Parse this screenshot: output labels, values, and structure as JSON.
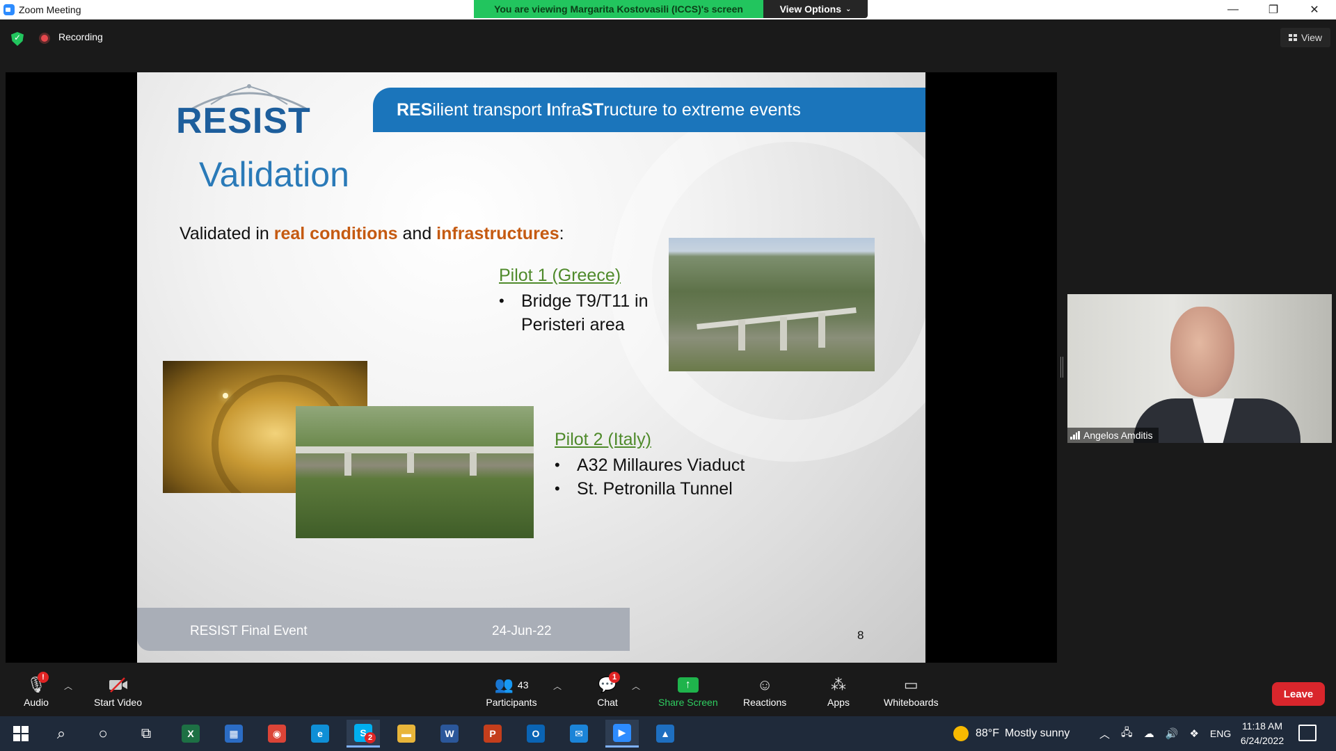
{
  "window": {
    "title": "Zoom Meeting",
    "viewing_banner": "You are viewing Margarita Kostovasili (ICCS)'s screen",
    "view_options": "View Options",
    "controls": {
      "minimize": "—",
      "restore": "❐",
      "close": "✕"
    }
  },
  "meeting": {
    "recording_label": "Recording",
    "view_label": "View"
  },
  "slide": {
    "logo_text": "RESIST",
    "header": {
      "part1": "RES",
      "part2": "ilient transport ",
      "part3": "I",
      "part4": "nfra",
      "part5": "ST",
      "part6": "ructure to extreme events"
    },
    "title": "Validation",
    "intro": {
      "prefix": "Validated in ",
      "hl1": "real conditions",
      "mid": " and ",
      "hl2": "infrastructures",
      "suffix": ":"
    },
    "pilot1": {
      "title": "Pilot 1 (Greece)",
      "items": [
        "Bridge T9/T11 in Peristeri area"
      ]
    },
    "pilot2": {
      "title": "Pilot 2 (Italy)",
      "items": [
        "A32 Millaures Viaduct",
        "St. Petronilla Tunnel"
      ]
    },
    "bullet": "•",
    "footer": {
      "left": "RESIST Final Event",
      "date": "24-Jun-22",
      "page": "8"
    }
  },
  "participant": {
    "name": "Angelos Amditis"
  },
  "toolbar": {
    "audio": "Audio",
    "audio_badge": "!",
    "start_video": "Start Video",
    "participants": "Participants",
    "participants_count": "43",
    "chat": "Chat",
    "chat_badge": "1",
    "share_screen": "Share Screen",
    "reactions": "Reactions",
    "apps": "Apps",
    "whiteboards": "Whiteboards",
    "leave": "Leave"
  },
  "taskbar": {
    "weather_temp": "88°F",
    "weather_text": "Mostly sunny",
    "language": "ENG",
    "time": "11:18 AM",
    "date": "6/24/2022",
    "skype_badge": "2",
    "apps": [
      {
        "name": "excel",
        "glyph": "X",
        "color": "#1d7044"
      },
      {
        "name": "store",
        "glyph": "▦",
        "color": "#2b6cc4"
      },
      {
        "name": "chrome",
        "glyph": "◉",
        "color": "#db4437"
      },
      {
        "name": "edge",
        "glyph": "e",
        "color": "#0f8fd6"
      },
      {
        "name": "skype",
        "glyph": "S",
        "color": "#00aff0"
      },
      {
        "name": "explorer",
        "glyph": "▬",
        "color": "#e8b53a"
      },
      {
        "name": "word",
        "glyph": "W",
        "color": "#2b579a"
      },
      {
        "name": "powerpoint",
        "glyph": "P",
        "color": "#c43e1c"
      },
      {
        "name": "outlook",
        "glyph": "O",
        "color": "#0a64b4"
      },
      {
        "name": "mail",
        "glyph": "✉",
        "color": "#1b84d8"
      },
      {
        "name": "zoom",
        "glyph": "▶",
        "color": "#2d8cff"
      },
      {
        "name": "photos",
        "glyph": "▲",
        "color": "#1e6fc0"
      }
    ]
  }
}
